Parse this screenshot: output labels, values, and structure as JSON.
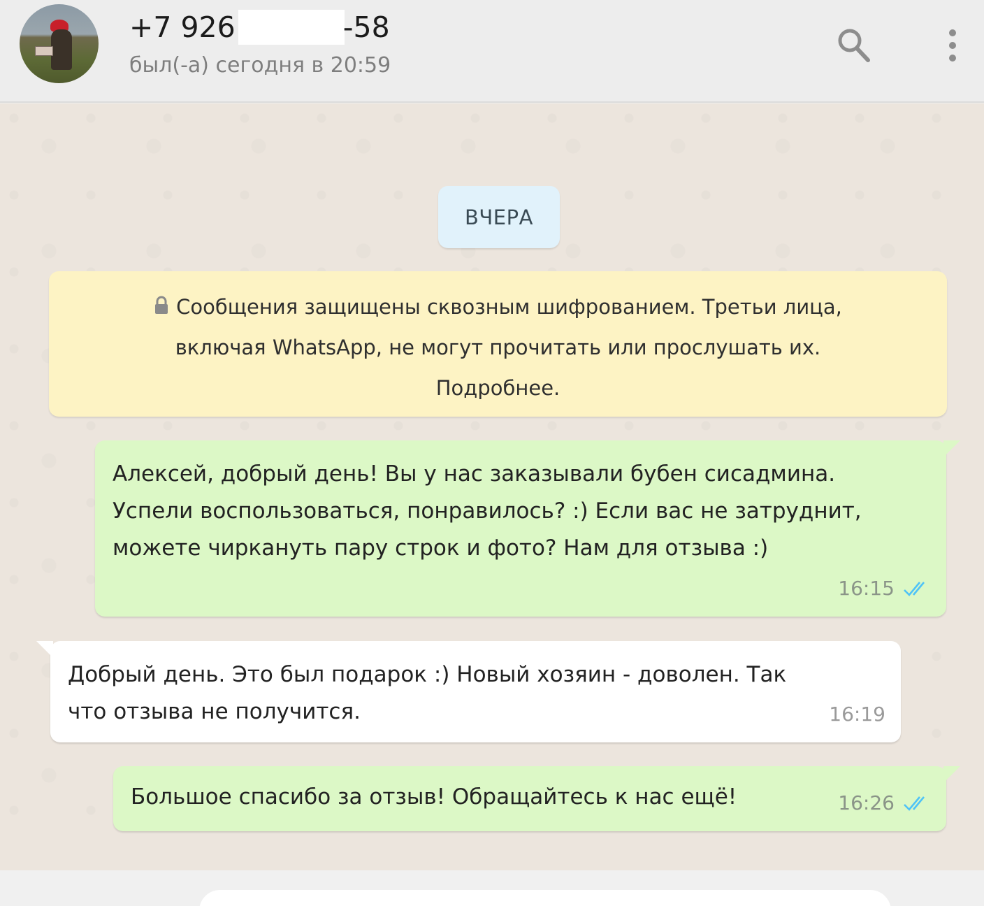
{
  "header": {
    "contact_prefix": "+7 926",
    "contact_suffix": "-58",
    "status": "был(-а) сегодня в 20:59"
  },
  "chat": {
    "date_label": "ВЧЕРА",
    "encryption_notice_line1": "Сообщения защищены сквозным шифрованием. Третьи лица,",
    "encryption_notice_line2": "включая WhatsApp, не могут прочитать или прослушать их.",
    "encryption_notice_line3": "Подробнее.",
    "messages": [
      {
        "direction": "outgoing",
        "lines": [
          "Алексей, добрый день! Вы у нас заказывали бубен сисадмина.",
          "Успели воспользоваться, понравилось? :) Если вас не затруднит,",
          "можете чиркануть пару строк и фото? Нам для отзыва :)"
        ],
        "time": "16:15",
        "status": "read"
      },
      {
        "direction": "incoming",
        "lines": [
          "Добрый день. Это был подарок :)  Новый хозяин - доволен. Так",
          "что отзыва не получится."
        ],
        "time": "16:19"
      },
      {
        "direction": "outgoing",
        "lines": [
          "Большое спасибо за отзыв! Обращайтесь к нас ещё!"
        ],
        "time": "16:26",
        "status": "read"
      }
    ]
  },
  "colors": {
    "outgoing_bubble": "#dcf8c6",
    "incoming_bubble": "#ffffff",
    "notice_bg": "#fdf3c4",
    "date_chip_bg": "#e1f2fb",
    "read_ticks": "#4fc3f7"
  },
  "icons": {
    "search": "search-icon",
    "menu": "menu-dots-icon",
    "lock": "lock-icon",
    "read_receipt": "double-check-icon"
  }
}
